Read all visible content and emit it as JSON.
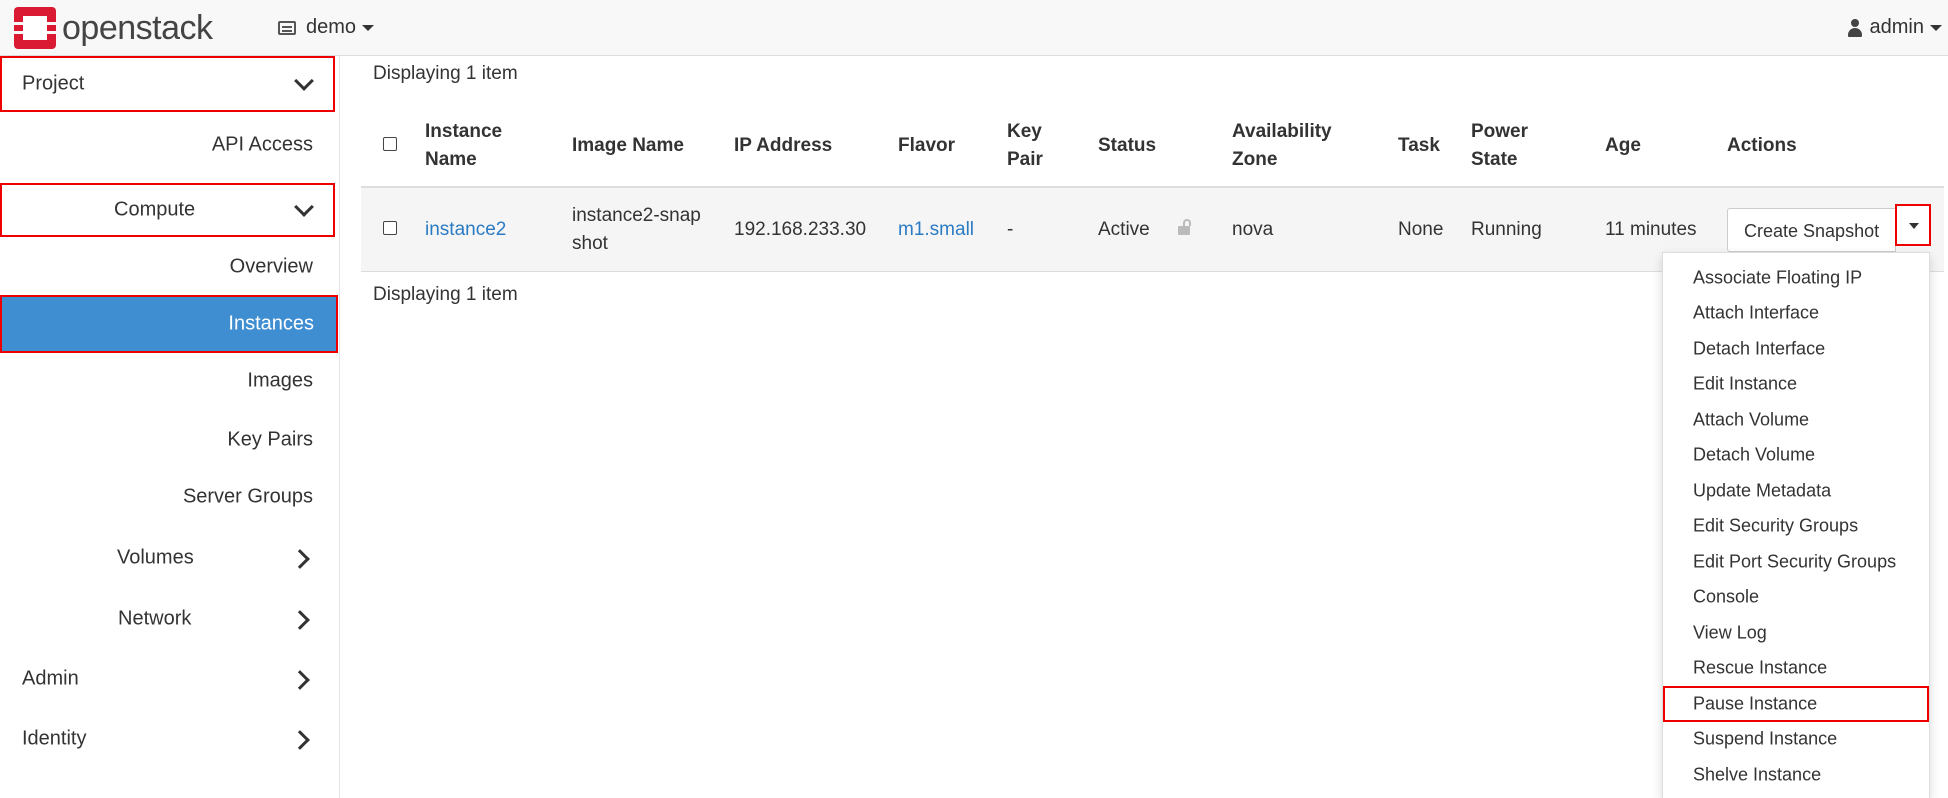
{
  "header": {
    "logo_text": "openstack",
    "project_selector": "demo",
    "user_menu": "admin"
  },
  "sidebar": {
    "project": "Project",
    "api_access": "API Access",
    "compute": "Compute",
    "overview": "Overview",
    "instances": "Instances",
    "images": "Images",
    "key_pairs": "Key Pairs",
    "server_groups": "Server Groups",
    "volumes": "Volumes",
    "network": "Network",
    "admin": "Admin",
    "identity": "Identity"
  },
  "main": {
    "displaying_top": "Displaying 1 item",
    "displaying_bottom": "Displaying 1 item",
    "columns": {
      "instance_name_1": "Instance",
      "instance_name_2": "Name",
      "image_name": "Image Name",
      "ip_address": "IP Address",
      "flavor": "Flavor",
      "key_pair_1": "Key",
      "key_pair_2": "Pair",
      "status": "Status",
      "az_1": "Availability",
      "az_2": "Zone",
      "task": "Task",
      "power_1": "Power",
      "power_2": "State",
      "age": "Age",
      "actions": "Actions"
    },
    "rows": [
      {
        "instance_name": "instance2",
        "image_name_1": "instance2-snap",
        "image_name_2": "shot",
        "ip_address": "192.168.233.30",
        "flavor": "m1.small",
        "key_pair": "-",
        "status": "Active",
        "availability_zone": "nova",
        "task": "None",
        "power_state": "Running",
        "age": "11 minutes",
        "action_button": "Create Snapshot"
      }
    ]
  },
  "actions_menu": [
    "Associate Floating IP",
    "Attach Interface",
    "Detach Interface",
    "Edit Instance",
    "Attach Volume",
    "Detach Volume",
    "Update Metadata",
    "Edit Security Groups",
    "Edit Port Security Groups",
    "Console",
    "View Log",
    "Rescue Instance",
    "Pause Instance",
    "Suspend Instance",
    "Shelve Instance"
  ],
  "colors": {
    "brand_red": "#da1a32",
    "active_blue": "#3f8ed2",
    "link_blue": "#2a7bc4",
    "highlight_red": "#e00000"
  }
}
